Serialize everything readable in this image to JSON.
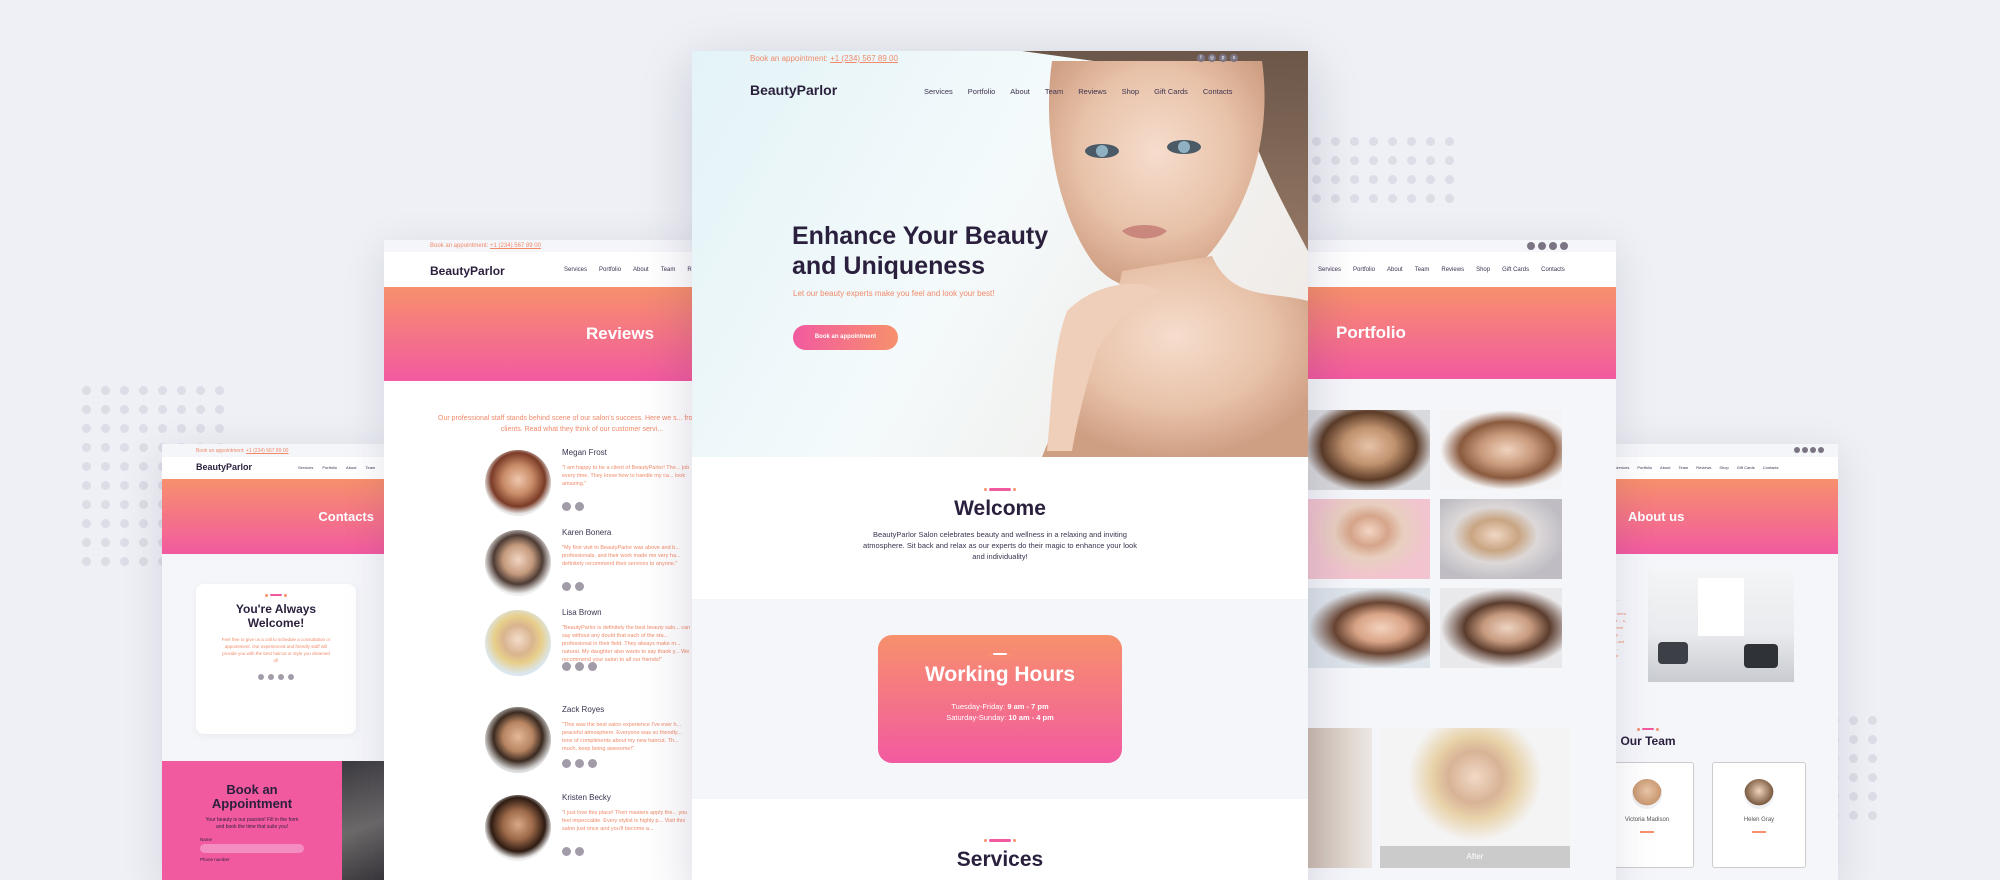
{
  "brand": "BeautyParlor",
  "appointment_text": "Book an appointment:",
  "phone": "+1 (234) 567 89 00",
  "nav_main": [
    "Services",
    "Portfolio",
    "About",
    "Team",
    "Reviews",
    "Shop",
    "Gift Cards",
    "Contacts"
  ],
  "hero": {
    "title_line1": "Enhance Your Beauty",
    "title_line2": "and Uniqueness",
    "subtitle": "Let our beauty experts make you feel and look your best!",
    "button": "Book an appointment"
  },
  "welcome": {
    "title": "Welcome",
    "text": "BeautyParlor Salon celebrates beauty and wellness in a relaxing and inviting atmosphere. Sit back and relax as our experts do their magic to enhance your look and individuality!"
  },
  "hours": {
    "title": "Working Hours",
    "line1_label": "Tuesday-Friday:",
    "line1_value": "9 am - 7 pm",
    "line2_label": "Saturday-Sunday:",
    "line2_value": "10 am - 4 pm"
  },
  "services_title": "Services",
  "reviews": {
    "banner": "Reviews",
    "intro": "Our professional staff stands behind scene of our salon's success. Here we s... from satisfied clients. Read what they think of our customer servi...",
    "items": [
      {
        "name": "Megan Frost",
        "quote": "\"I am happy to be a client of BeautyParlor! The... job every time. They know how to handle my ca... look amazing.\""
      },
      {
        "name": "Karen Bonera",
        "quote": "\"My first visit to BeautyParlor was above and b... professionals, and their work made me very ha... definitely recommend their services to anyone.\""
      },
      {
        "name": "Lisa Brown",
        "quote": "\"BeautyParlor is definitely the best beauty salo... can say without any doubt that each of the sta... professional in their field. They always make m... natural. My daughter also wants to say thank y... We recommend your salon to all our friends!\""
      },
      {
        "name": "Zack Royes",
        "quote": "\"This was the best salon experience I've ever h... peaceful atmosphere. Everyone was so friendly... tons of compliments about my new haircut. Th... much, keep being awesome!\""
      },
      {
        "name": "Kristen Becky",
        "quote": "\"I just love this place! Their masters apply the... you feel impeccable. Every stylist is highly p... Visit this salon just once and you'll become a..."
      }
    ]
  },
  "contacts": {
    "banner": "Contacts",
    "title_line1": "You're Always",
    "title_line2": "Welcome!",
    "text": "Feel free to give us a call to schedule a consultation or appointment. Our experienced and friendly staff will provide you with the best haircut or style you dreamed of!",
    "book_title_line1": "Book an",
    "book_title_line2": "Appointment",
    "book_text": "Your beauty is our passion! Fill in the form and book the time that suits you!",
    "field_name": "Name",
    "field_phone": "Phone number"
  },
  "portfolio": {
    "banner": "Portfolio",
    "after_label": "After"
  },
  "about": {
    "banner": "About us",
    "text": "... salon ... place ... client ... ment ... ty and ... s, and ... ment ... ct only ... features and ... for a ... style and",
    "team_title": "Our Team",
    "member1": "Victoria Madison",
    "member2": "Helen Gray"
  },
  "colors": {
    "accent_orange": "#f7906c",
    "accent_pink": "#f25aa0",
    "heading_dark": "#2a1f3d",
    "background": "#eef0f5"
  },
  "icons": [
    "facebook-icon",
    "instagram-icon",
    "pinterest-icon",
    "skype-icon",
    "google-plus-icon",
    "twitter-icon"
  ]
}
